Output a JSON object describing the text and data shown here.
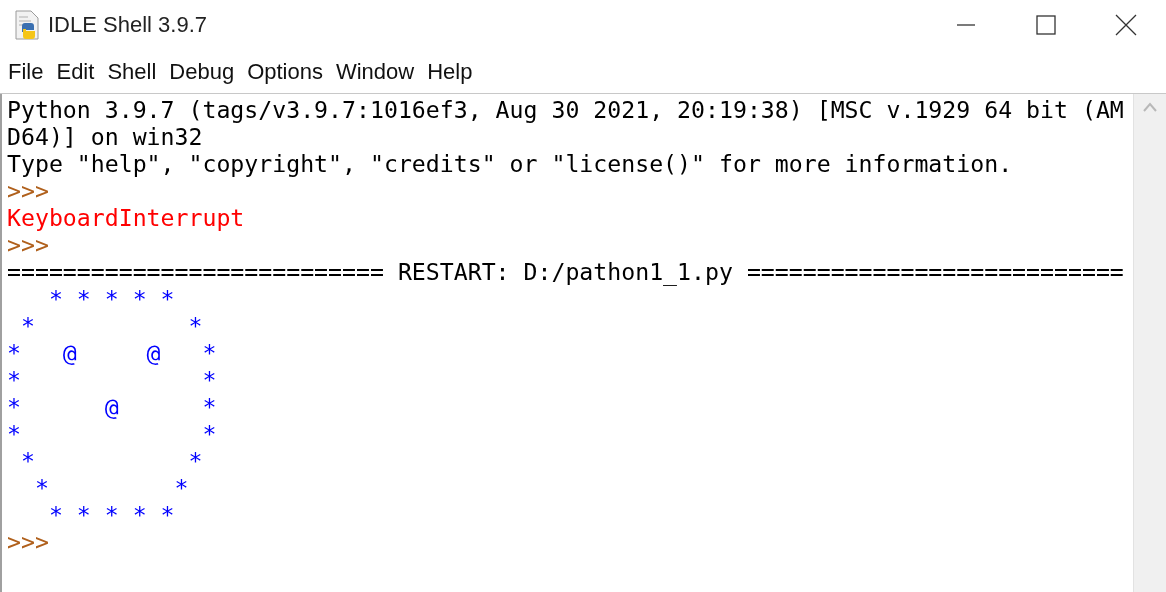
{
  "window": {
    "title": "IDLE Shell 3.9.7"
  },
  "menu": [
    "File",
    "Edit",
    "Shell",
    "Debug",
    "Options",
    "Window",
    "Help"
  ],
  "shell": {
    "lines": [
      {
        "kind": "output",
        "text": "Python 3.9.7 (tags/v3.9.7:1016ef3, Aug 30 2021, 20:19:38) [MSC v.1929 64 bit (AM"
      },
      {
        "kind": "output",
        "text": "D64)] on win32"
      },
      {
        "kind": "output",
        "text": "Type \"help\", \"copyright\", \"credits\" or \"license()\" for more information."
      },
      {
        "kind": "prompt",
        "text": ">>>"
      },
      {
        "kind": "error",
        "text": "KeyboardInterrupt"
      },
      {
        "kind": "prompt",
        "text": ">>>"
      },
      {
        "kind": "output",
        "text": "=========================== RESTART: D:/pathon1_1.py ==========================="
      },
      {
        "kind": "stdout",
        "text": "   * * * * *\n *           *\n*   @     @   *\n*             *\n*      @      *\n*             *\n *           *\n  *         *\n   * * * * *"
      },
      {
        "kind": "prompt",
        "text": ">>>"
      }
    ]
  }
}
